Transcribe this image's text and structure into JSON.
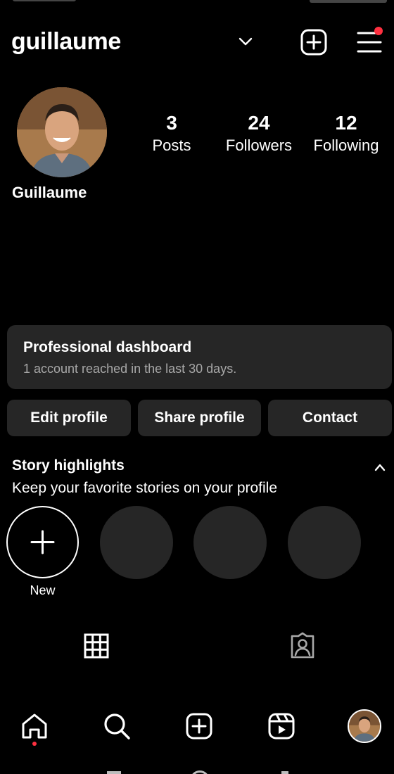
{
  "header": {
    "username": "guillaume",
    "menu_notification": true
  },
  "profile": {
    "display_name": "Guillaume",
    "stats": [
      {
        "value": "3",
        "label": "Posts"
      },
      {
        "value": "24",
        "label": "Followers"
      },
      {
        "value": "12",
        "label": "Following"
      }
    ]
  },
  "dashboard": {
    "title": "Professional dashboard",
    "subtitle": "1 account reached in the last 30 days."
  },
  "actions": {
    "edit": "Edit profile",
    "share": "Share profile",
    "contact": "Contact"
  },
  "highlights": {
    "title": "Story highlights",
    "subtitle": "Keep your favorite stories on your profile",
    "new_label": "New"
  },
  "tabs": [
    {
      "icon": "grid-icon",
      "selected": true
    },
    {
      "icon": "tagged-icon",
      "selected": false
    }
  ],
  "bottom_nav": [
    {
      "icon": "home-icon",
      "active": true
    },
    {
      "icon": "search-icon"
    },
    {
      "icon": "create-icon"
    },
    {
      "icon": "reels-icon"
    },
    {
      "icon": "profile-avatar"
    }
  ],
  "colors": {
    "background": "#000000",
    "surface": "#262626",
    "secondary_text": "#a8a8a8",
    "notification": "#ff3040"
  }
}
